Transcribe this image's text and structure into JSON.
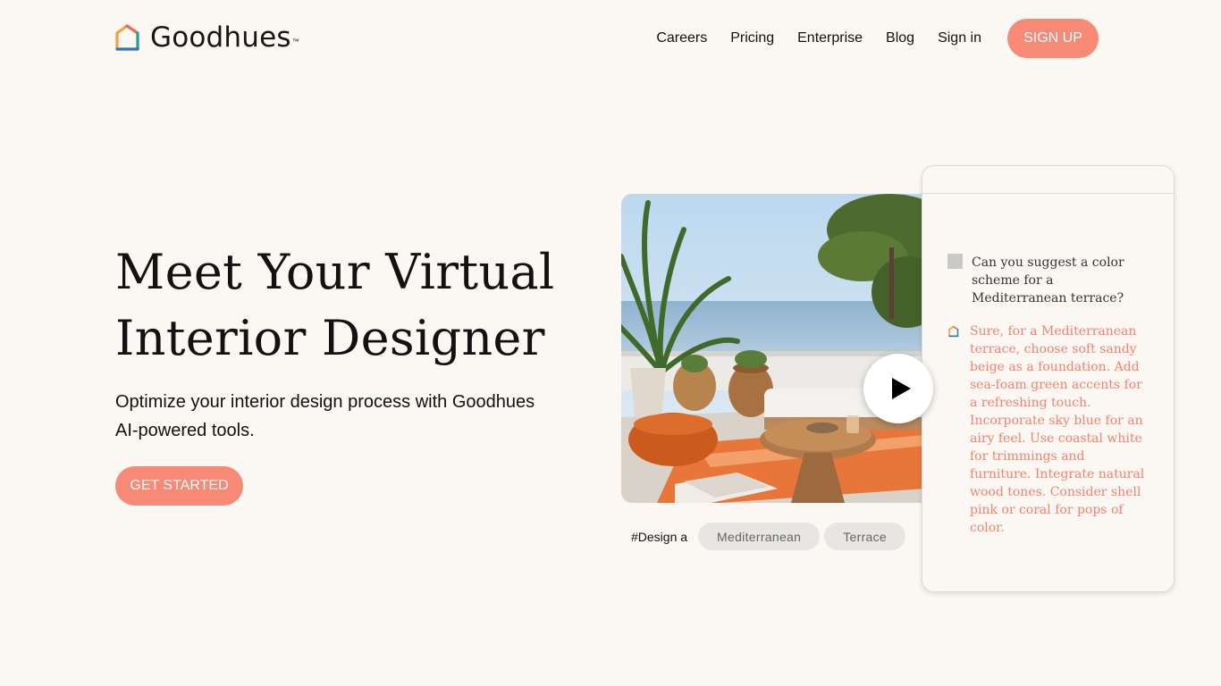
{
  "header": {
    "brand": "Goodhues",
    "brand_tm": "™",
    "nav": [
      "Careers",
      "Pricing",
      "Enterprise",
      "Blog",
      "Sign in"
    ],
    "signup_label": "SIGN UP"
  },
  "hero": {
    "title_line1": "Meet Your Virtual",
    "title_line2": "Interior Designer",
    "subtitle": "Optimize your interior design process with Goodhues AI-powered tools.",
    "cta_label": "GET STARTED"
  },
  "demo": {
    "tag_prefix": "#Design a",
    "tags": [
      "Mediterranean",
      "Terrace"
    ],
    "chat": {
      "question": "Can you suggest a color scheme for a Mediterranean terrace?",
      "answer": "Sure, for a Mediterranean terrace, choose soft sandy beige as a foundation. Add sea-foam green accents for a refreshing touch. Incorporate sky blue for an airy feel. Use coastal white for trimmings and furniture. Integrate natural wood tones. Consider shell pink or coral for pops of color."
    }
  },
  "colors": {
    "accent": "#f68a77",
    "answer_text": "#f4816d",
    "background": "#fbf8f4"
  },
  "icons": {
    "logo": "house-outline-logo",
    "play": "play-icon",
    "user": "user-avatar-icon"
  }
}
